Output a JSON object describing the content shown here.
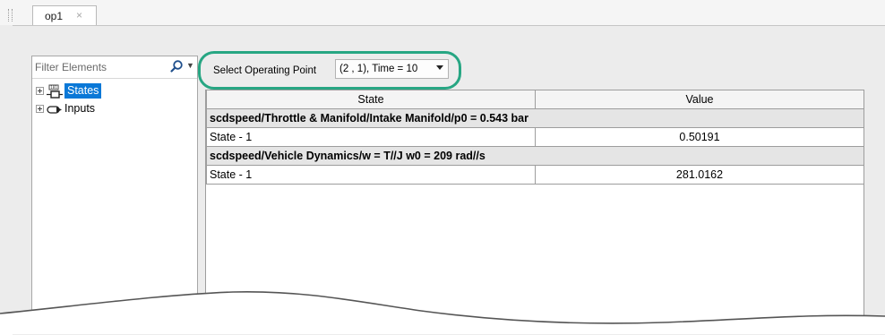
{
  "tab": {
    "title": "op1",
    "close_glyph": "×"
  },
  "browser": {
    "filter_placeholder": "Filter Elements",
    "search_icon": "magnifier-icon",
    "tree": [
      {
        "label": "States",
        "icon": "states-block-icon",
        "selected": true
      },
      {
        "label": "Inputs",
        "icon": "inputs-port-icon",
        "selected": false
      }
    ]
  },
  "operating_point": {
    "label": "Select Operating Point",
    "selected": "(2 , 1), Time = 10"
  },
  "table": {
    "columns": [
      "State",
      "Value"
    ],
    "groups": [
      {
        "title": "scdspeed/Throttle & Manifold/Intake Manifold/p0 = 0.543 bar",
        "rows": [
          {
            "state": "State - 1",
            "value": "0.50191"
          }
        ]
      },
      {
        "title": "scdspeed/Vehicle Dynamics/w = T//J w0 = 209 rad//s",
        "rows": [
          {
            "state": "State - 1",
            "value": "281.0162"
          }
        ]
      }
    ]
  },
  "colors": {
    "highlight_ring": "#27a683",
    "selection": "#0a78d7"
  }
}
